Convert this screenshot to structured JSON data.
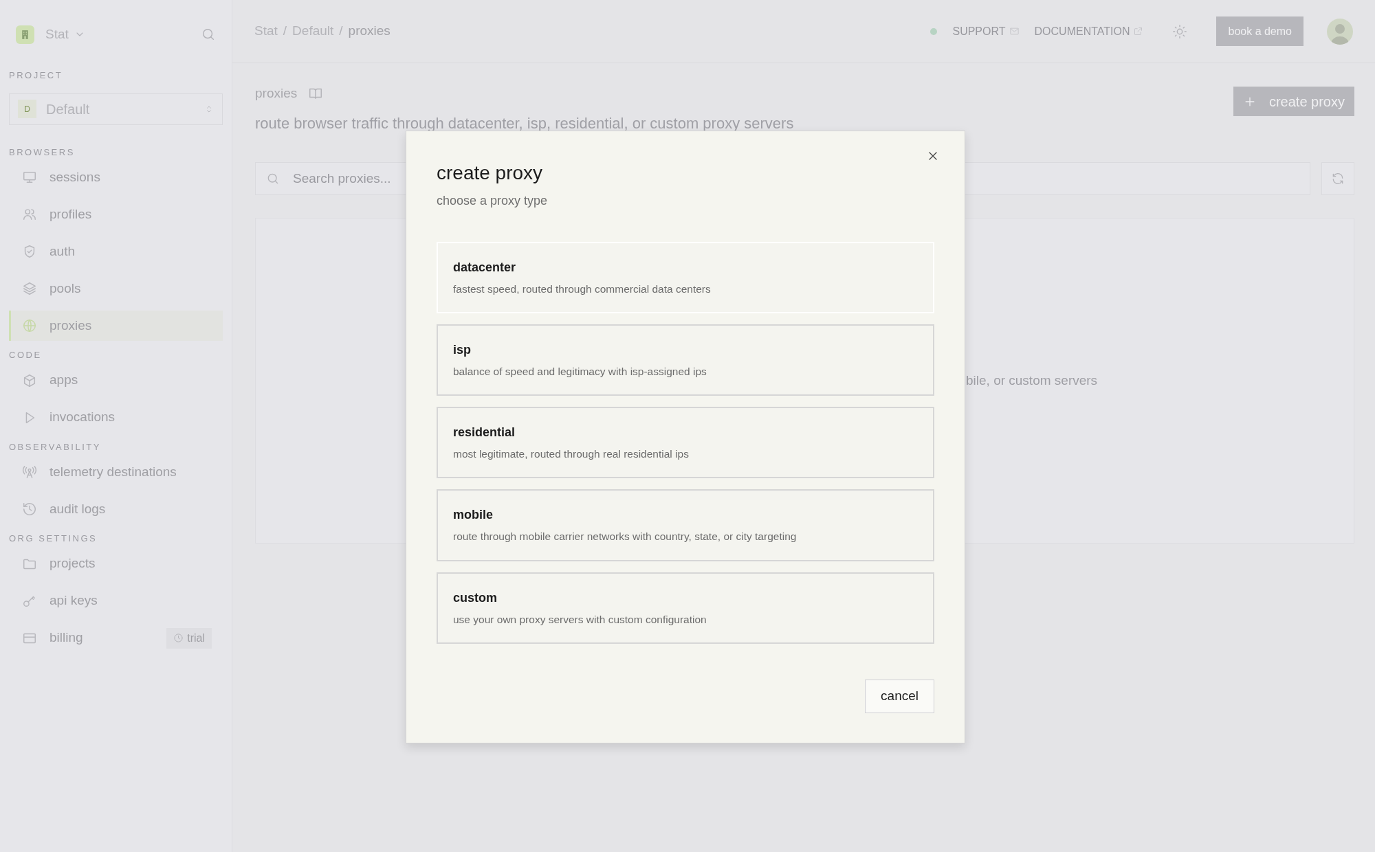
{
  "sidebar": {
    "org_name": "Stat",
    "project": {
      "label": "PROJECT",
      "badge": "D",
      "value": "Default"
    },
    "sections": [
      {
        "label": "BROWSERS",
        "items": [
          {
            "label": "sessions",
            "selected": false
          },
          {
            "label": "profiles",
            "selected": false
          },
          {
            "label": "auth",
            "selected": false
          },
          {
            "label": "pools",
            "selected": false
          },
          {
            "label": "proxies",
            "selected": true
          }
        ]
      },
      {
        "label": "CODE",
        "items": [
          {
            "label": "apps",
            "selected": false
          },
          {
            "label": "invocations",
            "selected": false
          }
        ]
      },
      {
        "label": "OBSERVABILITY",
        "items": [
          {
            "label": "telemetry destinations",
            "selected": false
          },
          {
            "label": "audit logs",
            "selected": false
          }
        ]
      },
      {
        "label": "ORG SETTINGS",
        "items": [
          {
            "label": "projects",
            "selected": false
          },
          {
            "label": "api keys",
            "selected": false
          },
          {
            "label": "billing",
            "selected": false,
            "badge": "trial"
          }
        ]
      }
    ]
  },
  "header": {
    "breadcrumb": [
      "Stat",
      "Default",
      "proxies"
    ],
    "separator": "/",
    "links": [
      "SUPPORT",
      "DOCUMENTATION"
    ],
    "demo_button": "book a demo"
  },
  "page": {
    "title": "proxies",
    "subtitle": "route browser traffic through datacenter, isp, residential, or custom proxy servers",
    "create_button": "create proxy",
    "search": {
      "placeholder": "Search proxies..."
    },
    "empty_text": "bile, or custom servers"
  },
  "modal": {
    "title": "create proxy",
    "subtitle": "choose a proxy type",
    "options": [
      {
        "title": "datacenter",
        "description": "fastest speed, routed through commercial data centers",
        "selected": true
      },
      {
        "title": "isp",
        "description": "balance of speed and legitimacy with isp-assigned ips",
        "selected": false
      },
      {
        "title": "residential",
        "description": "most legitimate, routed through real residential ips",
        "selected": false
      },
      {
        "title": "mobile",
        "description": "route through mobile carrier networks with country, state, or city targeting",
        "selected": false
      },
      {
        "title": "custom",
        "description": "use your own proxy servers with custom configuration",
        "selected": false
      }
    ],
    "cancel": "cancel"
  }
}
